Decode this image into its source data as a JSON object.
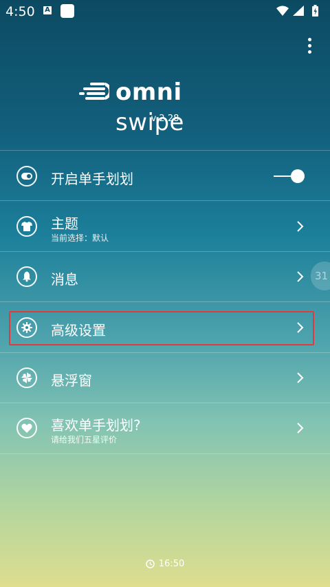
{
  "status": {
    "time": "4:50",
    "notif_a": "A",
    "icons": [
      "wifi-icon",
      "signal-icon",
      "battery-charging-icon"
    ]
  },
  "header": {
    "logo_bold": "omni",
    "logo_thin": " swipe",
    "version": "v 2.28"
  },
  "menu": {
    "items": [
      {
        "title": "开启单手划划",
        "icon": "toggle-switch-icon",
        "control": "toggle",
        "on": true
      },
      {
        "title": "主题",
        "subtitle": "当前选择：默认",
        "icon": "shirt-icon"
      },
      {
        "title": "消息",
        "icon": "bell-icon"
      },
      {
        "title": "高级设置",
        "icon": "gear-icon",
        "highlighted": true
      },
      {
        "title": "悬浮窗",
        "icon": "pinwheel-icon"
      },
      {
        "title": "喜欢单手划划?",
        "subtitle": "请给我们五星评价",
        "icon": "heart-icon"
      }
    ]
  },
  "side_badge": "31",
  "footer": {
    "clock_time": "16:50"
  },
  "colors": {
    "highlight": "#e03a3a",
    "top": "#0c4a62",
    "bottom": "#dede8e"
  }
}
